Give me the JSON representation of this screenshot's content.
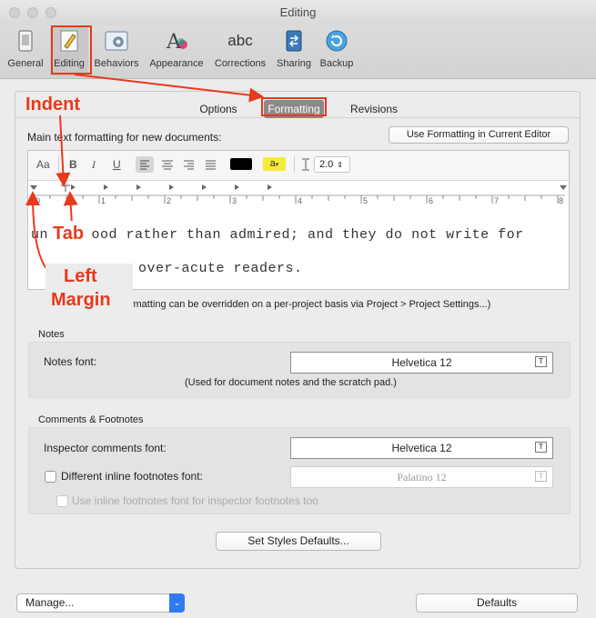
{
  "window": {
    "title": "Editing"
  },
  "toolbar": {
    "items": [
      {
        "label": "General"
      },
      {
        "label": "Editing"
      },
      {
        "label": "Behaviors"
      },
      {
        "label": "Appearance"
      },
      {
        "label": "Corrections"
      },
      {
        "label": "Sharing"
      },
      {
        "label": "Backup"
      }
    ],
    "selected": "Editing",
    "corrections_icon_text": "abc"
  },
  "tabs": [
    {
      "label": "Options"
    },
    {
      "label": "Formatting"
    },
    {
      "label": "Revisions"
    }
  ],
  "formatting": {
    "main_label": "Main text formatting for new documents:",
    "use_button": "Use Formatting in Current Editor",
    "format_bar": {
      "font": "Aa",
      "bold": "B",
      "italic": "I",
      "underline": "U",
      "highlight": "a",
      "line_spacing": "2.0"
    },
    "ruler_numbers": [
      "0",
      "1",
      "2",
      "3",
      "4",
      "5",
      "6",
      "7",
      "8"
    ],
    "preview_lines": [
      "understood rather than admired; and they do not write for",
      "over-acute readers."
    ],
    "note": "Formatting can be overridden on a per-project basis via Project > Project Settings...)"
  },
  "notes": {
    "section_title": "Notes",
    "font_label": "Notes font:",
    "font_value": "Helvetica 12",
    "hint": "(Used for document notes and the scratch pad.)"
  },
  "comments": {
    "section_title": "Comments & Footnotes",
    "inspector_label": "Inspector comments font:",
    "inspector_value": "Helvetica 12",
    "footnotes_checkbox": "Different inline footnotes font:",
    "footnotes_value": "Palatino 12",
    "inspector_footnotes_checkbox": "Use inline footnotes font for inspector footnotes too"
  },
  "set_styles_button": "Set Styles Defaults...",
  "bottom": {
    "manage": "Manage...",
    "defaults": "Defaults"
  },
  "annotations": {
    "indent": "Indent",
    "tab": "Tab",
    "left": "Left",
    "margin": "Margin"
  },
  "colors": {
    "annotation": "#e8391b",
    "selected_tab": "#8a8a8a"
  }
}
